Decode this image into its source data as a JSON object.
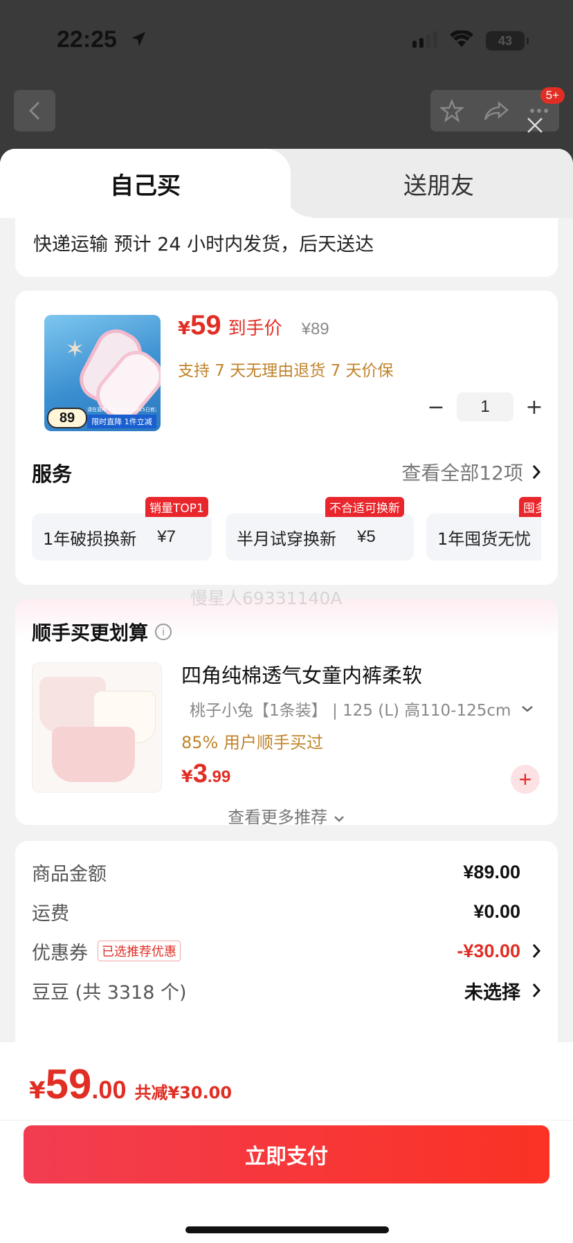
{
  "status_bar": {
    "time": "22:25",
    "battery": "43"
  },
  "header": {
    "badge": "5+"
  },
  "tabs": {
    "self": "自己买",
    "gift": "送朋友"
  },
  "shipping": {
    "text": "快递运输 预计 24 小时内发货，后天送达"
  },
  "product": {
    "price_symbol": "¥",
    "price": "59",
    "price_tag": "到手价",
    "original_price": "¥89",
    "policy": "支持 7 天无理由退货   7 天价保",
    "thumb_price": "89",
    "thumb_promo": "限时直降  1件立减",
    "thumb_promo_top": "请在直降  6月15日~7月15日官方",
    "quantity": "1",
    "minus": "−",
    "plus": "+"
  },
  "services": {
    "title": "服务",
    "view_all": "查看全部12项",
    "items": [
      {
        "label": "1年破损换新",
        "price": "¥7",
        "tag": "销量TOP1"
      },
      {
        "label": "半月试穿换新",
        "price": "¥5",
        "tag": "不合适可换新"
      },
      {
        "label": "1年囤货无忧",
        "price": "",
        "tag": "囤多换"
      }
    ]
  },
  "watermark": "慢星人69331140A",
  "recommend": {
    "title": "顺手买更划算",
    "info": "i",
    "item": {
      "name": "四角纯棉透气女童内裤柔软",
      "spec": "桃子小兔【1条装】  |  125 (L) 高110-125cm",
      "stat": "85% 用户顺手买过",
      "price_symbol": "¥",
      "price_int": "3",
      "price_dec": ".99",
      "add": "+"
    },
    "more": "查看更多推荐"
  },
  "summary": {
    "goods_label": "商品金额",
    "goods_value": "¥89.00",
    "shipping_label": "运费",
    "shipping_value": "¥0.00",
    "coupon_label": "优惠券",
    "coupon_tag": "已选推荐优惠",
    "coupon_value": "-¥30.00",
    "beans_label": "豆豆 (共 3318 个)",
    "beans_value": "未选择"
  },
  "footer": {
    "total_symbol": "¥",
    "total_int": "59",
    "total_dec": ".00",
    "saved": "共减¥30.00",
    "pay_button": "立即支付"
  },
  "colors": {
    "accent": "#e02e24",
    "button_start": "#f23d51",
    "button_end": "#fb3224",
    "policy": "#c0832a"
  }
}
